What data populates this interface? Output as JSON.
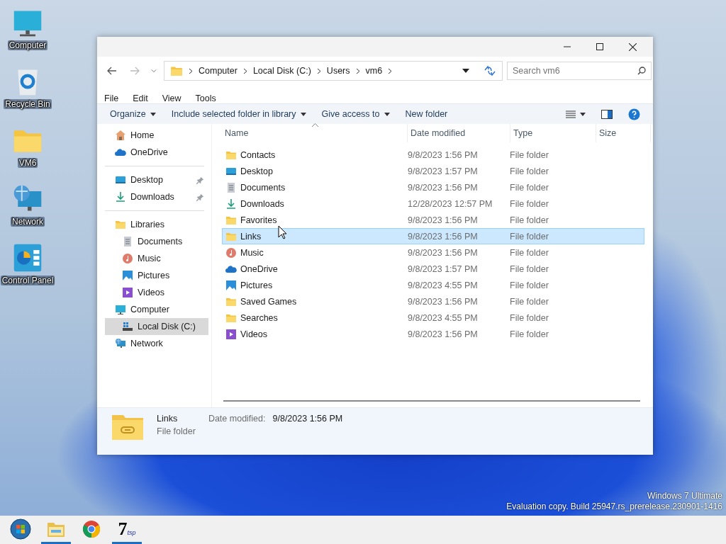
{
  "desktop_icons": [
    {
      "label": "Computer",
      "kind": "monitor"
    },
    {
      "label": "Recycle Bin",
      "kind": "recycle"
    },
    {
      "label": "VM6",
      "kind": "folder"
    },
    {
      "label": "Network",
      "kind": "network"
    },
    {
      "label": "Control Panel",
      "kind": "control"
    }
  ],
  "window": {
    "address": {
      "crumbs": [
        "Computer",
        "Local Disk (C:)",
        "Users",
        "vm6"
      ]
    },
    "search": {
      "placeholder": "Search vm6"
    },
    "menu": [
      "File",
      "Edit",
      "View",
      "Tools"
    ],
    "commands": [
      {
        "label": "Organize",
        "dropdown": true
      },
      {
        "label": "Include selected folder in library",
        "dropdown": true
      },
      {
        "label": "Give access to",
        "dropdown": true
      },
      {
        "label": "New folder",
        "dropdown": false
      }
    ],
    "nav": [
      [
        {
          "label": "Home",
          "kind": "home",
          "selected": false
        },
        {
          "label": "OneDrive",
          "kind": "onedrive",
          "selected": false
        }
      ],
      [
        {
          "label": "Desktop",
          "kind": "desktop",
          "selected": false,
          "pinned": true
        },
        {
          "label": "Downloads",
          "kind": "downloads",
          "selected": false,
          "pinned": true
        }
      ],
      [
        {
          "label": "Libraries",
          "kind": "folder",
          "selected": false,
          "children": [
            {
              "label": "Documents",
              "kind": "documents",
              "selected": false
            },
            {
              "label": "Music",
              "kind": "music",
              "selected": false
            },
            {
              "label": "Pictures",
              "kind": "pictures",
              "selected": false
            },
            {
              "label": "Videos",
              "kind": "videos",
              "selected": false
            }
          ]
        },
        {
          "label": "Computer",
          "kind": "monitor",
          "selected": false,
          "children": [
            {
              "label": "Local Disk (C:)",
              "kind": "drive",
              "selected": true
            }
          ]
        },
        {
          "label": "Network",
          "kind": "network",
          "selected": false
        }
      ]
    ],
    "columns": [
      {
        "label": "Name",
        "sorted": true
      },
      {
        "label": "Date modified",
        "sorted": false
      },
      {
        "label": "Type",
        "sorted": false
      },
      {
        "label": "Size",
        "sorted": false
      }
    ],
    "rows": [
      {
        "name": "Contacts",
        "kind": "folder",
        "date": "9/8/2023 1:56 PM",
        "type": "File folder",
        "selected": false
      },
      {
        "name": "Desktop",
        "kind": "desktop",
        "date": "9/8/2023 1:57 PM",
        "type": "File folder",
        "selected": false
      },
      {
        "name": "Documents",
        "kind": "documents",
        "date": "9/8/2023 1:56 PM",
        "type": "File folder",
        "selected": false
      },
      {
        "name": "Downloads",
        "kind": "downloads",
        "date": "12/28/2023 12:57 PM",
        "type": "File folder",
        "selected": false
      },
      {
        "name": "Favorites",
        "kind": "folder",
        "date": "9/8/2023 1:56 PM",
        "type": "File folder",
        "selected": false
      },
      {
        "name": "Links",
        "kind": "folder",
        "date": "9/8/2023 1:56 PM",
        "type": "File folder",
        "selected": true
      },
      {
        "name": "Music",
        "kind": "music",
        "date": "9/8/2023 1:56 PM",
        "type": "File folder",
        "selected": false
      },
      {
        "name": "OneDrive",
        "kind": "onedrive",
        "date": "9/8/2023 1:57 PM",
        "type": "File folder",
        "selected": false
      },
      {
        "name": "Pictures",
        "kind": "pictures",
        "date": "9/8/2023 4:55 PM",
        "type": "File folder",
        "selected": false
      },
      {
        "name": "Saved Games",
        "kind": "folder",
        "date": "9/8/2023 1:56 PM",
        "type": "File folder",
        "selected": false
      },
      {
        "name": "Searches",
        "kind": "folder",
        "date": "9/8/2023 4:55 PM",
        "type": "File folder",
        "selected": false
      },
      {
        "name": "Videos",
        "kind": "videos",
        "date": "9/8/2023 1:56 PM",
        "type": "File folder",
        "selected": false
      }
    ],
    "details": {
      "name": "Links",
      "type": "File folder",
      "date_label": "Date modified:",
      "date": "9/8/2023 1:56 PM"
    }
  },
  "watermark": [
    "Windows 7 Ultimate",
    "Evaluation copy. Build 25947.rs_prerelease.230901-1416"
  ],
  "taskbar": [
    {
      "kind": "start",
      "running": false
    },
    {
      "kind": "explorer",
      "running": true
    },
    {
      "kind": "chrome",
      "running": false
    },
    {
      "kind": "logo",
      "text": "7",
      "sub": "tsp",
      "running": true
    }
  ]
}
